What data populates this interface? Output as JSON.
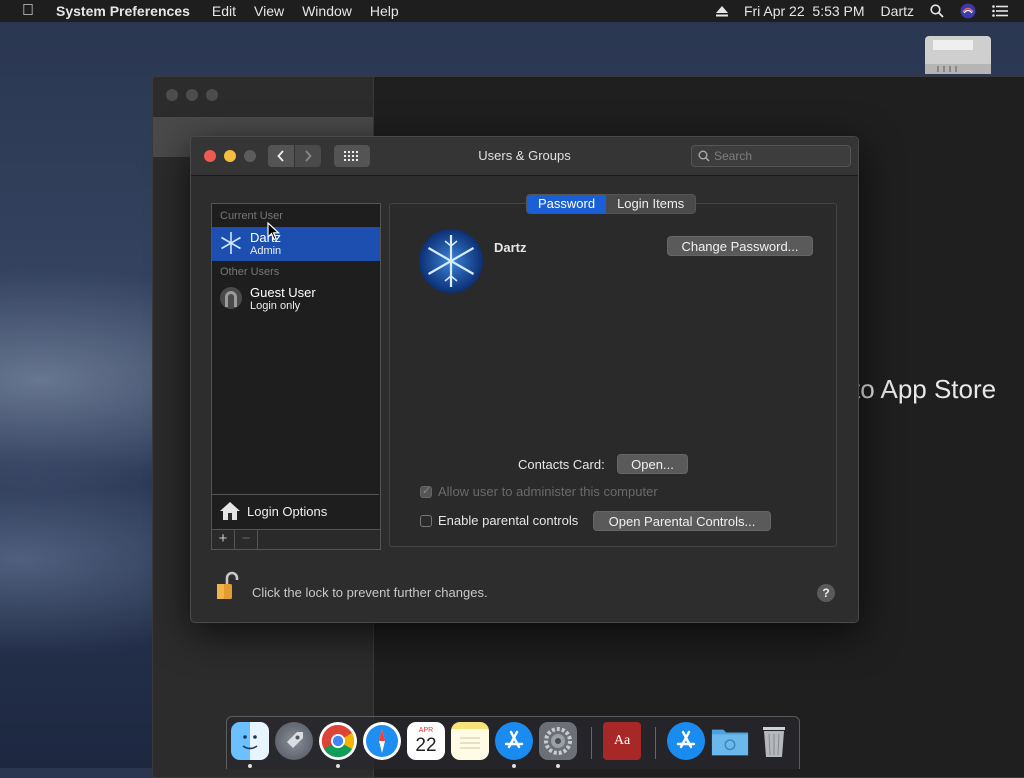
{
  "menubar": {
    "app_name": "System Preferences",
    "menus": [
      "Edit",
      "View",
      "Window",
      "Help"
    ],
    "datetime": "Fri Apr 22  5:53 PM",
    "user": "Dartz"
  },
  "background_window": {
    "visible_text": "to App Store"
  },
  "dialog": {
    "title": "Users & Groups",
    "search_placeholder": "Search"
  },
  "users_list": {
    "current_user_header": "Current User",
    "other_users_header": "Other Users",
    "current_user": {
      "name": "Dartz",
      "role": "Admin"
    },
    "other_users": [
      {
        "name": "Guest User",
        "role": "Login only"
      }
    ],
    "login_options_label": "Login Options",
    "add_symbol": "+",
    "remove_symbol": "−"
  },
  "tabs": {
    "password": "Password",
    "login_items": "Login Items",
    "active": "Password"
  },
  "user_detail": {
    "name": "Dartz",
    "change_password_button": "Change Password...",
    "contacts_card_label": "Contacts Card:",
    "open_button": "Open...",
    "allow_admin_label": "Allow user to administer this computer",
    "allow_admin_checked": true,
    "parental_controls_label": "Enable parental controls",
    "parental_controls_checked": false,
    "open_parental_controls_button": "Open Parental Controls..."
  },
  "footer": {
    "lock_text": "Click the lock to prevent further changes.",
    "help_symbol": "?"
  },
  "dock": {
    "calendar_month": "APR",
    "calendar_day": "22",
    "dictionary_text": "Aa",
    "apps": [
      "finder-icon",
      "launchpad-icon",
      "chrome-icon",
      "safari-icon",
      "calendar-icon",
      "notes-icon",
      "app-store-icon",
      "system-preferences-icon",
      "dictionary-icon",
      "app-store-folder-icon",
      "downloads-folder-icon",
      "trash-icon"
    ]
  },
  "colors": {
    "accent_blue": "#1d4fb0",
    "tab_active": "#1a5fd6",
    "close": "#ee5a52",
    "minimize": "#f5bd3b"
  }
}
